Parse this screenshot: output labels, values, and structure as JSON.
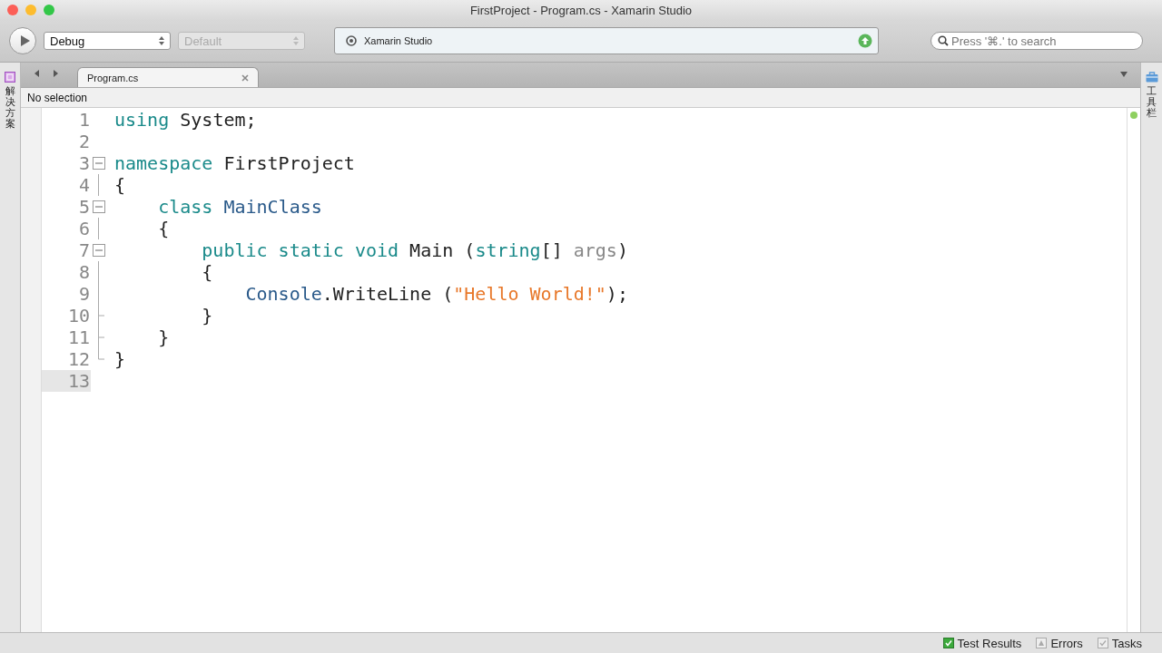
{
  "window": {
    "title": "FirstProject - Program.cs - Xamarin Studio"
  },
  "toolbar": {
    "configuration": "Debug",
    "target": "Default",
    "target_disabled": true,
    "status": "Xamarin Studio",
    "search": {
      "placeholder": "Press '⌘.' to search"
    }
  },
  "left_pad": {
    "label": "解决方案"
  },
  "right_pad": {
    "label": "工具栏"
  },
  "tabs": [
    {
      "label": "Program.cs",
      "selected": true
    }
  ],
  "breadcrumb": "No selection",
  "code_lines": [
    {
      "number": "1",
      "kind": "none",
      "current": false,
      "tokens": [
        {
          "kind": "keyword",
          "text": "using"
        },
        {
          "kind": "plain",
          "text": " System;"
        }
      ]
    },
    {
      "number": "2",
      "kind": "none",
      "current": false
    },
    {
      "number": "3",
      "kind": "start",
      "current": false,
      "tokens": [
        {
          "kind": "keyword",
          "text": "namespace"
        },
        {
          "kind": "plain",
          "text": " FirstProject"
        }
      ]
    },
    {
      "number": "4",
      "kind": "line",
      "current": false,
      "tokens": [
        {
          "kind": "plain",
          "text": "{"
        }
      ]
    },
    {
      "number": "5",
      "kind": "start",
      "current": false,
      "tokens": [
        {
          "kind": "keyword",
          "text": "    class "
        },
        {
          "kind": "type",
          "text": "MainClass"
        }
      ]
    },
    {
      "number": "6",
      "kind": "line",
      "current": false,
      "tokens": [
        {
          "kind": "plain",
          "text": "    {"
        }
      ]
    },
    {
      "number": "7",
      "kind": "start",
      "current": false,
      "tokens": [
        {
          "kind": "keyword",
          "text": "        public static void"
        },
        {
          "kind": "plain",
          "text": " Main ("
        },
        {
          "kind": "keyword",
          "text": "string"
        },
        {
          "kind": "plain",
          "text": "[] "
        },
        {
          "kind": "param",
          "text": "args"
        },
        {
          "kind": "plain",
          "text": ")"
        }
      ]
    },
    {
      "number": "8",
      "kind": "line",
      "current": false,
      "tokens": [
        {
          "kind": "plain",
          "text": "        {"
        }
      ]
    },
    {
      "number": "9",
      "kind": "line",
      "current": false,
      "tokens": [
        {
          "kind": "type",
          "text": "            Console"
        },
        {
          "kind": "plain",
          "text": ".WriteLine ("
        },
        {
          "kind": "string",
          "text": "\"Hello World!\""
        },
        {
          "kind": "plain",
          "text": ");"
        }
      ]
    },
    {
      "number": "10",
      "kind": "tee",
      "current": false,
      "tokens": [
        {
          "kind": "plain",
          "text": "        }"
        }
      ]
    },
    {
      "number": "11",
      "kind": "tee",
      "current": false,
      "tokens": [
        {
          "kind": "plain",
          "text": "    }"
        }
      ]
    },
    {
      "number": "12",
      "kind": "end",
      "current": false,
      "tokens": [
        {
          "kind": "plain",
          "text": "}"
        }
      ]
    },
    {
      "number": "13",
      "kind": "none",
      "current": true
    }
  ],
  "status_bar": [
    {
      "label": "Test Results",
      "kind": "tests"
    },
    {
      "label": "Errors",
      "kind": "errors"
    },
    {
      "label": "Tasks",
      "kind": "tasks"
    }
  ]
}
